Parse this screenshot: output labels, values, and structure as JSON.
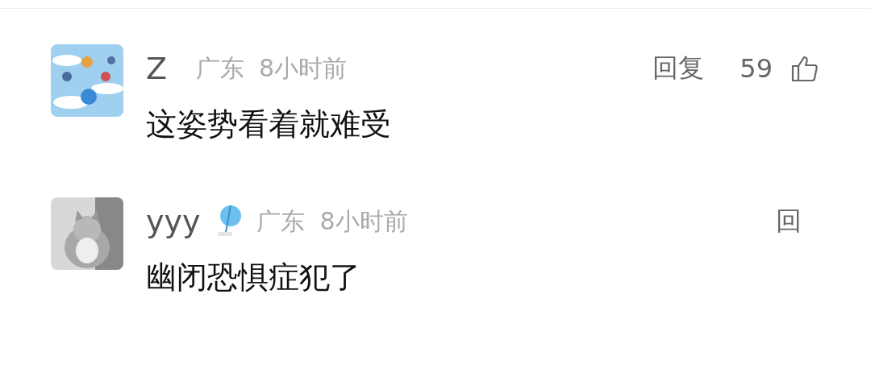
{
  "comments": [
    {
      "user": "Z",
      "badge": false,
      "location": "广东",
      "time": "8小时前",
      "text": "这姿势看着就难受",
      "reply": "回复",
      "likes": "59"
    },
    {
      "user": "yyy",
      "badge": true,
      "location": "广东",
      "time": "8小时前",
      "text": "幽闭恐惧症犯了",
      "reply": "回"
    }
  ]
}
